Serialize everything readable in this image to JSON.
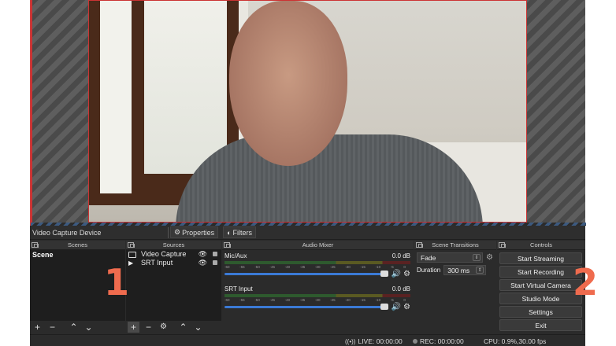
{
  "context_bar": {
    "source_name": "Video Capture Device",
    "properties_label": "Properties",
    "filters_label": "Filters"
  },
  "scenes": {
    "title": "Scenes",
    "items": [
      "Scene"
    ]
  },
  "sources": {
    "title": "Sources",
    "items": [
      {
        "label": "Video Capture",
        "icon": "camera-icon"
      },
      {
        "label": "SRT Input",
        "icon": "play-icon"
      }
    ]
  },
  "audio_mixer": {
    "title": "Audio Mixer",
    "ticks": [
      "-60",
      "-55",
      "-50",
      "-45",
      "-40",
      "-35",
      "-30",
      "-25",
      "-20",
      "-15",
      "-10",
      "-5",
      "0"
    ],
    "channels": [
      {
        "name": "Mic/Aux",
        "level": "0.0 dB"
      },
      {
        "name": "SRT Input",
        "level": "0.0 dB"
      }
    ]
  },
  "transitions": {
    "title": "Scene Transitions",
    "selected": "Fade",
    "duration_label": "Duration",
    "duration_value": "300 ms"
  },
  "controls": {
    "title": "Controls",
    "buttons": [
      "Start Streaming",
      "Start Recording",
      "Start Virtual Camera",
      "Studio Mode",
      "Settings",
      "Exit"
    ]
  },
  "status": {
    "live": "LIVE: 00:00:00",
    "rec": "REC: 00:00:00",
    "cpu": "CPU: 0.9%,30.00 fps"
  },
  "annotations": [
    "1",
    "2"
  ],
  "colors": {
    "accent": "#3b7ad6",
    "annotation": "#ef6b4e",
    "panel_bg": "#2b2b2b"
  }
}
